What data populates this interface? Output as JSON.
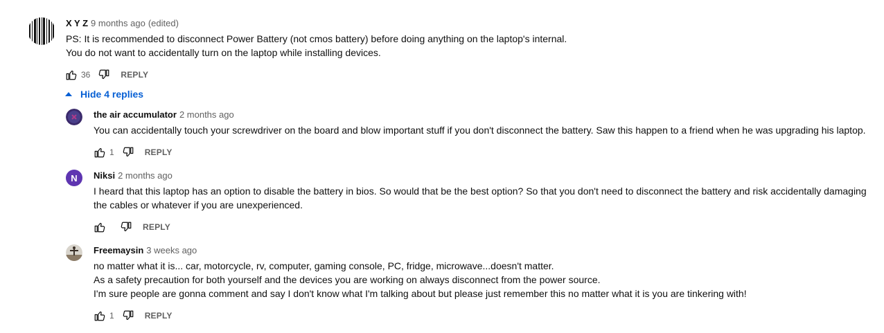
{
  "comments": [
    {
      "author": "X Y Z",
      "time": "9 months ago",
      "edited": "(edited)",
      "lines": [
        "PS: It is recommended to disconnect Power Battery (not cmos battery) before doing anything on the laptop's internal.",
        "You do not want to accidentally turn on the laptop while installing devices."
      ],
      "likes": "36",
      "reply_label": "REPLY",
      "avatar_icon": "barcode-avatar"
    }
  ],
  "toggle_replies": "Hide 4 replies",
  "replies": [
    {
      "author": "the air accumulator",
      "time": "2 months ago",
      "lines": [
        "You can accidentally touch your screwdriver on the board and blow important stuff if you don't disconnect the battery. Saw this happen to a friend when he was upgrading his laptop."
      ],
      "likes": "1",
      "reply_label": "REPLY",
      "avatar_icon": "dark-purple-avatar"
    },
    {
      "author": "Niksi",
      "time": "2 months ago",
      "lines": [
        "I heard that this laptop has an option to disable the battery in bios. So would that be the best option? So that you don't need to disconnect the battery and risk accidentally damaging",
        "the cables or whatever if you are unexperienced."
      ],
      "likes": "",
      "reply_label": "REPLY",
      "avatar_letter": "N",
      "avatar_color": "#5e35b1"
    },
    {
      "author": "Freemaysin",
      "time": "3 weeks ago",
      "lines": [
        "no matter what it is... car, motorcycle, rv, computer, gaming console, PC, fridge, microwave...doesn't matter.",
        "As a safety precaution for both yourself and the devices you are working on always disconnect from the power source.",
        "I'm sure people are gonna comment and say I don't know what I'm talking about but please just remember this no matter what it is you are tinkering with!"
      ],
      "likes": "1",
      "reply_label": "REPLY",
      "avatar_icon": "photo-avatar"
    }
  ]
}
